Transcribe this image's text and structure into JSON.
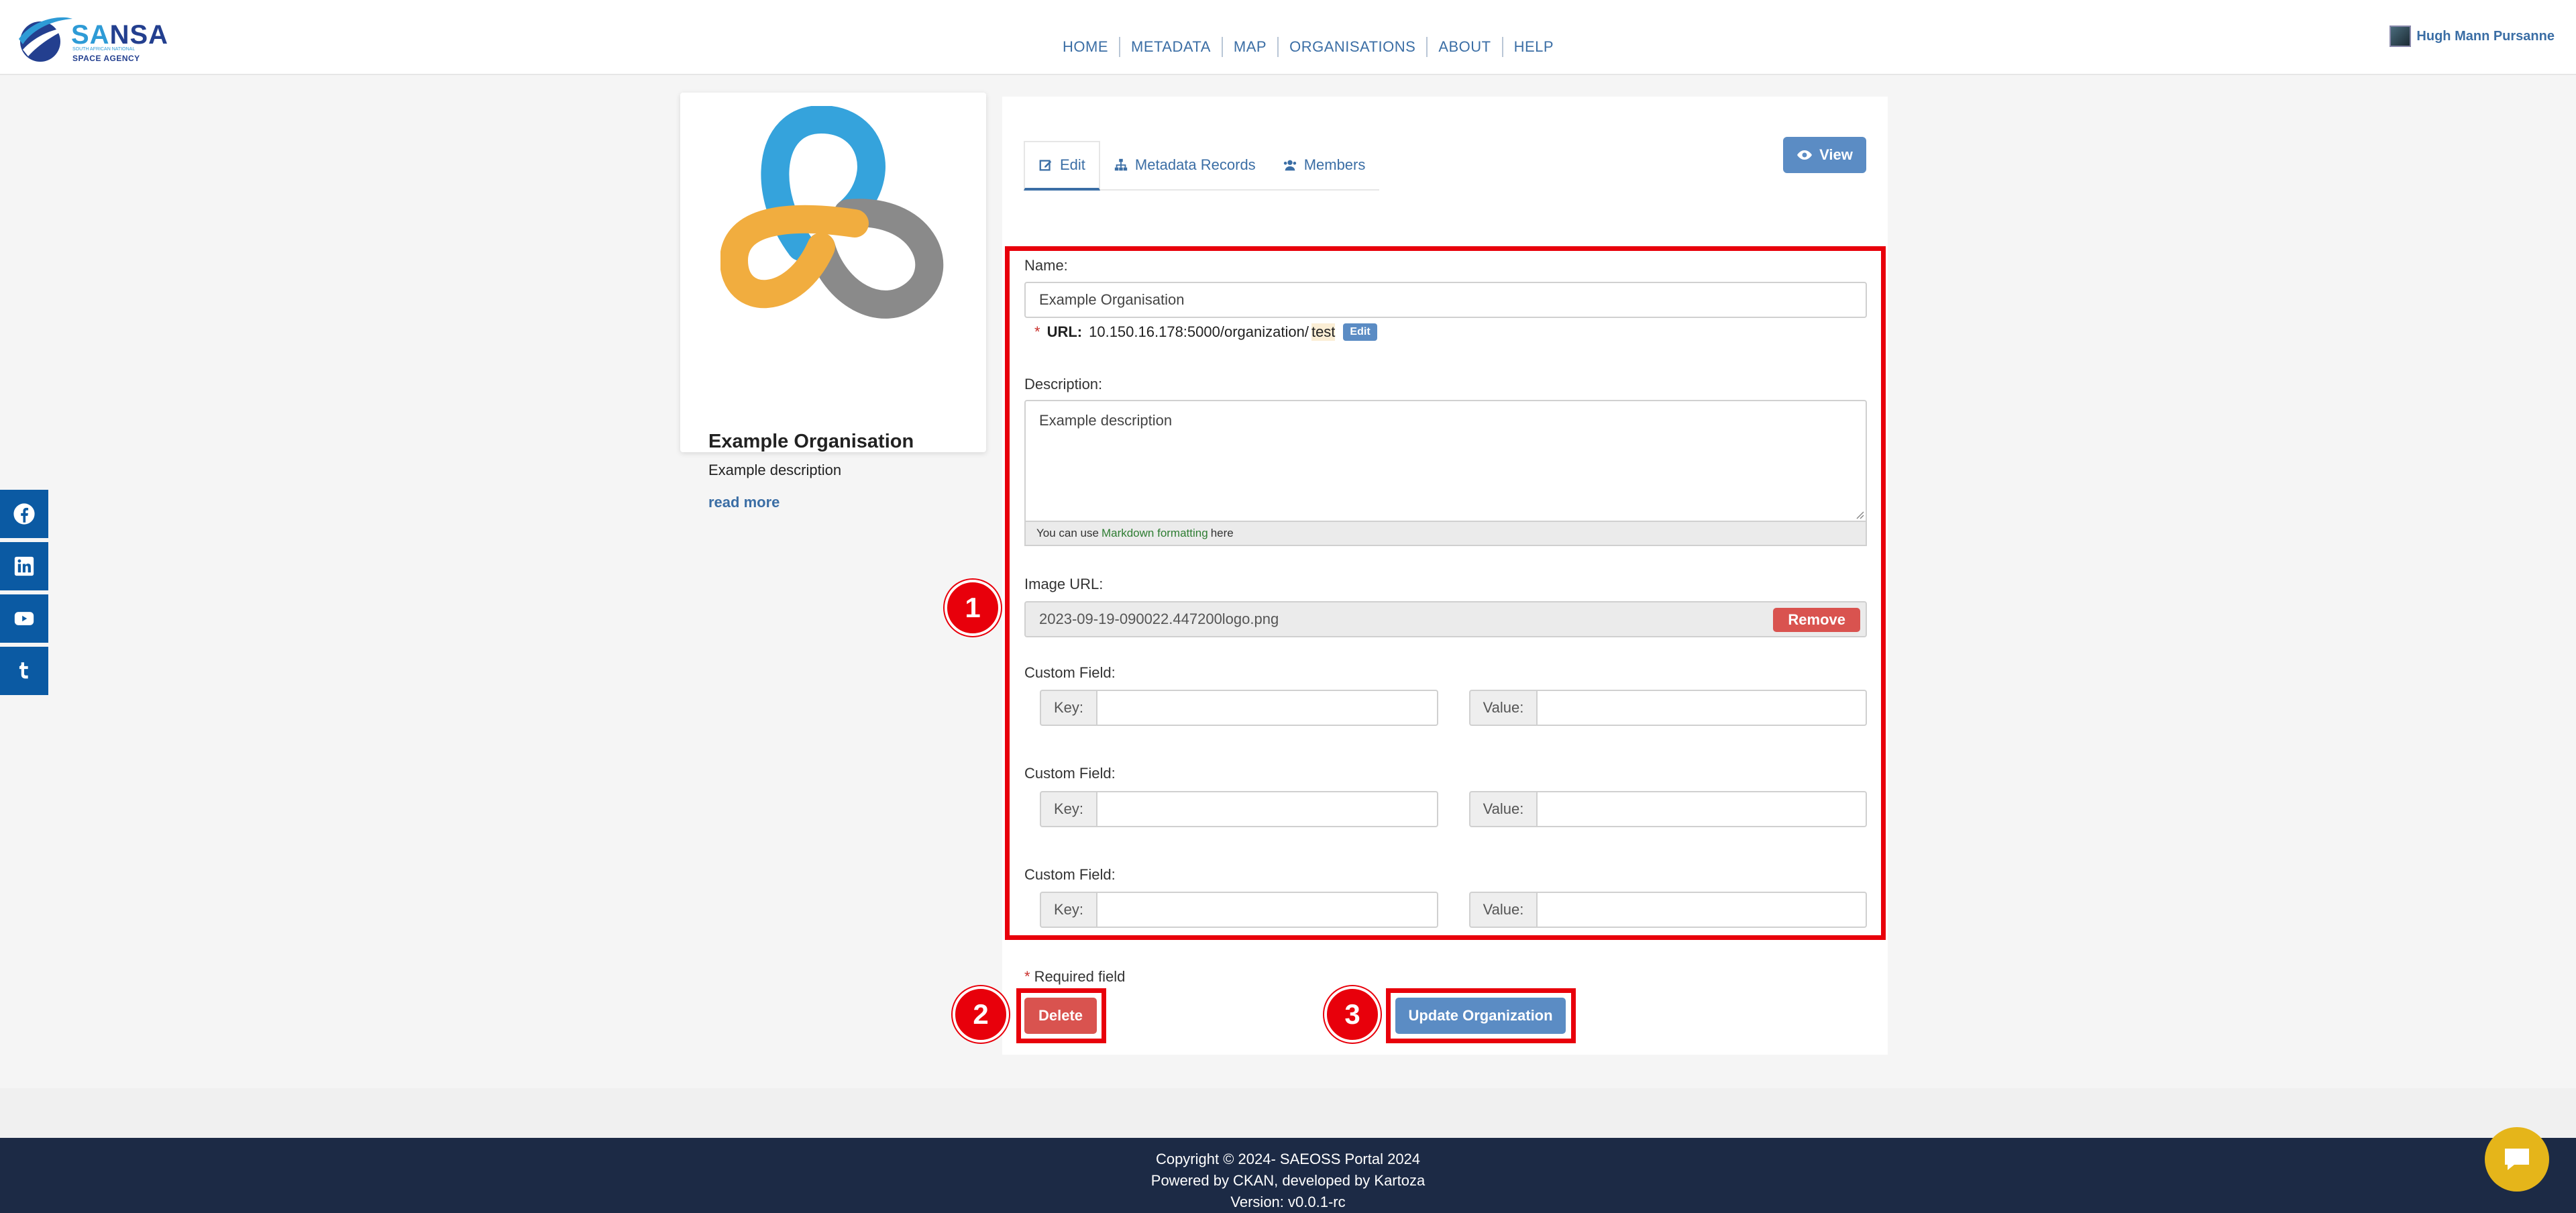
{
  "brand": {
    "name_sa": "SA",
    "name_rest": "NSA",
    "tiny": "SOUTH AFRICAN NATIONAL",
    "sub": "SPACE AGENCY"
  },
  "nav": [
    "HOME",
    "METADATA",
    "MAP",
    "ORGANISATIONS",
    "ABOUT",
    "HELP"
  ],
  "user": {
    "name": "Hugh Mann Pursanne"
  },
  "social": [
    "facebook-icon",
    "linkedin-icon",
    "youtube-icon",
    "tumblr-icon"
  ],
  "org_card": {
    "title": "Example Organisation",
    "description": "Example description",
    "read_more": "read more"
  },
  "tabs": [
    {
      "label": "Edit",
      "icon": "edit-icon",
      "active": true
    },
    {
      "label": "Metadata Records",
      "icon": "sitemap-icon",
      "active": false
    },
    {
      "label": "Members",
      "icon": "users-icon",
      "active": false
    }
  ],
  "view_button": "View",
  "form": {
    "name_label": "Name:",
    "name_value": "Example Organisation",
    "url_required": "*",
    "url_label": "URL:",
    "url_prefix": "10.150.16.178:5000/organization/",
    "url_slug": "test",
    "url_edit": "Edit",
    "description_label": "Description:",
    "description_value": "Example description",
    "md_note_before": "You can use",
    "md_note_link": "Markdown formatting",
    "md_note_after": "here",
    "image_label": "Image URL:",
    "image_value": "2023-09-19-090022.447200logo.png",
    "remove_button": "Remove",
    "custom_fields": [
      {
        "label": "Custom Field:",
        "key_label": "Key:",
        "value_label": "Value:"
      },
      {
        "label": "Custom Field:",
        "key_label": "Key:",
        "value_label": "Value:"
      },
      {
        "label": "Custom Field:",
        "key_label": "Key:",
        "value_label": "Value:"
      }
    ],
    "required_star": "*",
    "required_text": "Required field",
    "delete_button": "Delete",
    "update_button": "Update Organization"
  },
  "annotations": [
    "1",
    "2",
    "3"
  ],
  "colors": {
    "highlight": "#e8000b",
    "primary_button": "#5b8cc4",
    "danger_button": "#d9534f",
    "footer": "#1c2a45",
    "chat": "#e5b51a"
  },
  "footer": {
    "line1": "Copyright © 2024- SAEOSS Portal 2024",
    "line2": "Powered by CKAN, developed by Kartoza",
    "line3": "Version: v0.0.1-rc"
  }
}
